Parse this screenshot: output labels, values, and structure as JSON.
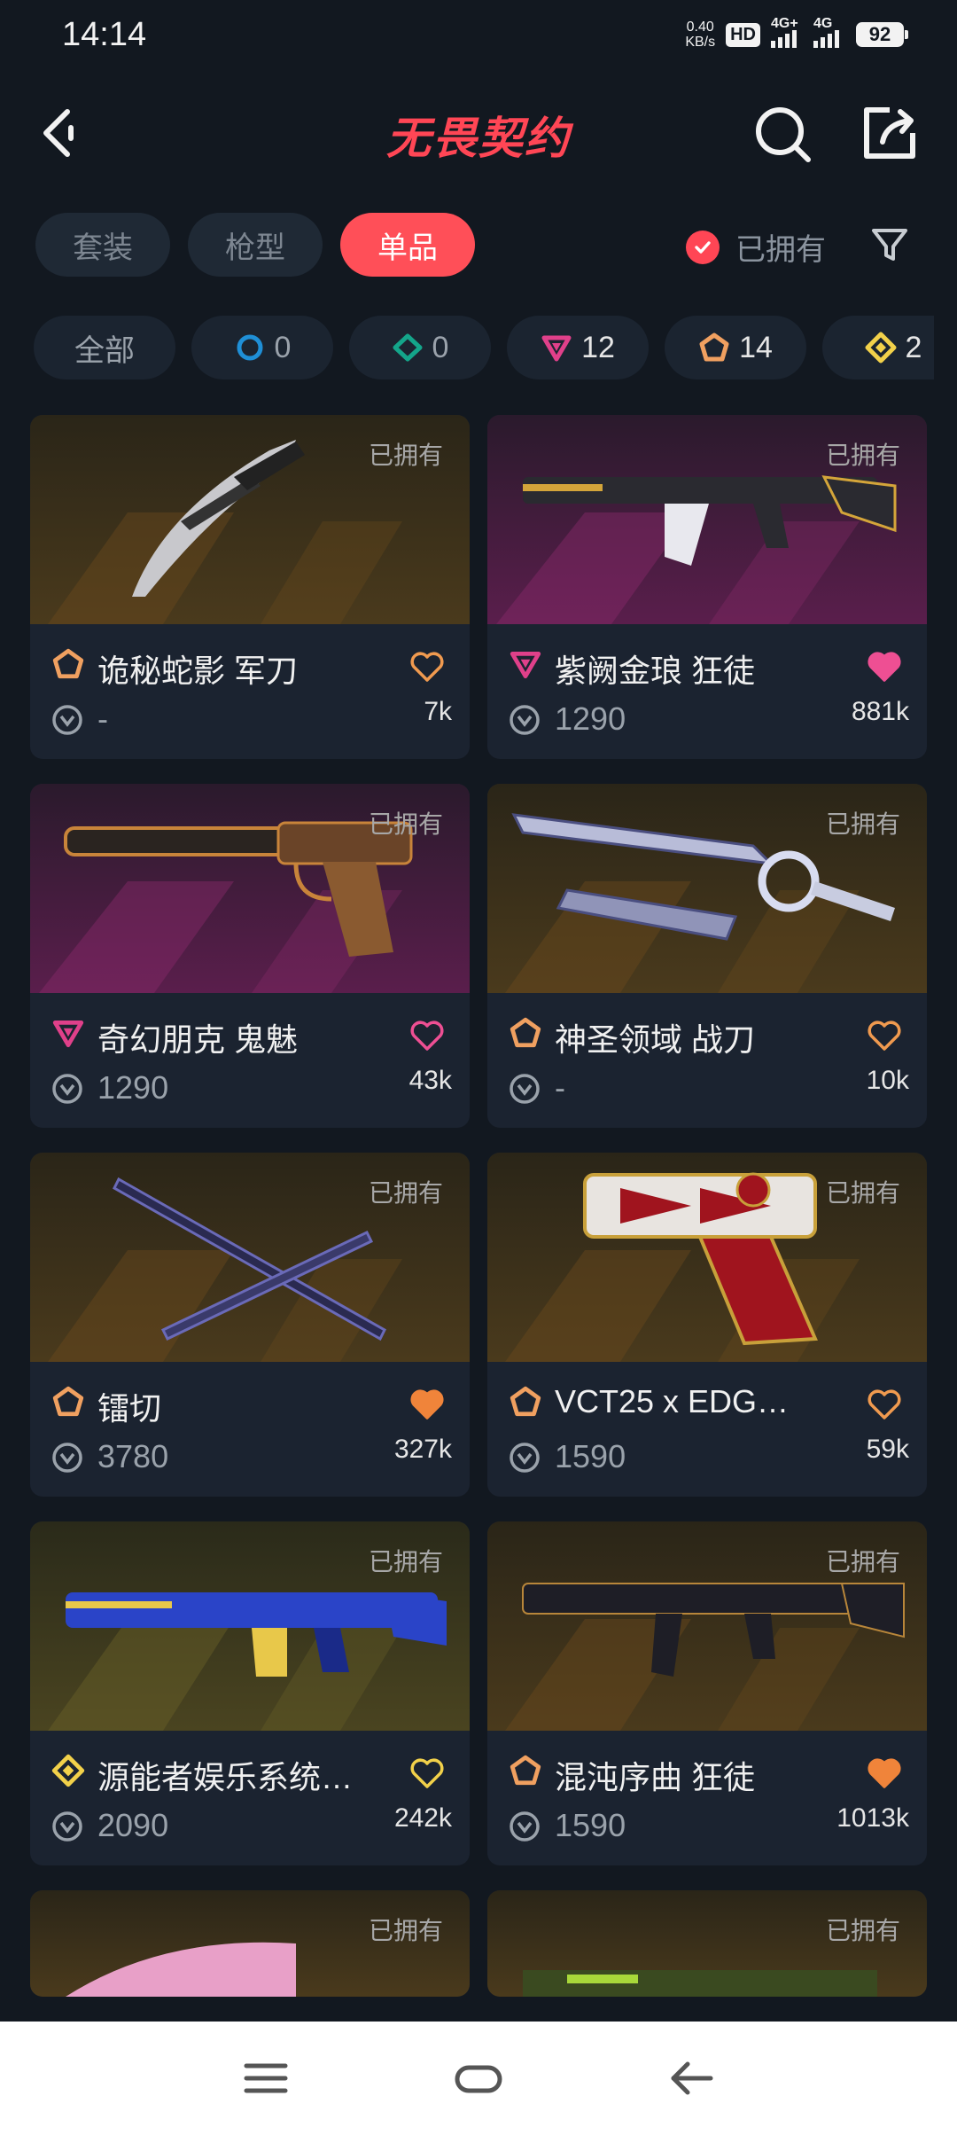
{
  "status": {
    "time": "14:14",
    "speed_top": "0.40",
    "speed_bottom": "KB/s",
    "hd": "HD",
    "net1": "4G+",
    "net2": "4G",
    "battery": "92"
  },
  "header": {
    "title": "无畏契约",
    "title_color": "#ff4655"
  },
  "tabs": [
    {
      "label": "套装"
    },
    {
      "label": "枪型"
    },
    {
      "label": "单品"
    }
  ],
  "owned_filter": {
    "label": "已拥有",
    "checked": true
  },
  "rarity_filters": [
    {
      "label": "全部",
      "icon": "none"
    },
    {
      "label": "0",
      "icon": "select-tier-icon",
      "color": "#1f8fd6"
    },
    {
      "label": "0",
      "icon": "deluxe-tier-icon",
      "color": "#14a58a"
    },
    {
      "label": "12",
      "icon": "premium-tier-icon",
      "color": "#e0408a"
    },
    {
      "label": "14",
      "icon": "exclusive-tier-icon",
      "color": "#f0a060"
    },
    {
      "label": "2",
      "icon": "ultra-tier-icon",
      "color": "#f2d14a"
    }
  ],
  "cards": [
    {
      "name": "诡秘蛇影 军刀",
      "price": "-",
      "likes": "7k",
      "owned": "已拥有",
      "rarity": "exclusive",
      "liked": false,
      "heart_color": "#f09a4f"
    },
    {
      "name": "紫阙金琅 狂徒",
      "price": "1290",
      "likes": "881k",
      "owned": "已拥有",
      "rarity": "premium",
      "liked": true,
      "heart_color": "#ee4f93"
    },
    {
      "name": "奇幻朋克 鬼魅",
      "price": "1290",
      "likes": "43k",
      "owned": "已拥有",
      "rarity": "premium",
      "liked": false,
      "heart_color": "#ee4f93"
    },
    {
      "name": "神圣领域 战刀",
      "price": "-",
      "likes": "10k",
      "owned": "已拥有",
      "rarity": "exclusive",
      "liked": false,
      "heart_color": "#f09a4f"
    },
    {
      "name": "镭切",
      "price": "3780",
      "likes": "327k",
      "owned": "已拥有",
      "rarity": "exclusive",
      "liked": true,
      "heart_color": "#f0843a"
    },
    {
      "name": "VCT25 x EDG…",
      "price": "1590",
      "likes": "59k",
      "owned": "已拥有",
      "rarity": "exclusive",
      "liked": false,
      "heart_color": "#f09a4f"
    },
    {
      "name": "源能者娱乐系统…",
      "price": "2090",
      "likes": "242k",
      "owned": "已拥有",
      "rarity": "ultra",
      "liked": false,
      "heart_color": "#f2d14a"
    },
    {
      "name": "混沌序曲 狂徒",
      "price": "1590",
      "likes": "1013k",
      "owned": "已拥有",
      "rarity": "exclusive",
      "liked": true,
      "heart_color": "#f0843a"
    },
    {
      "name": "",
      "price": "",
      "likes": "",
      "owned": "已拥有",
      "rarity": "",
      "liked": false,
      "heart_color": ""
    },
    {
      "name": "",
      "price": "",
      "likes": "",
      "owned": "已拥有",
      "rarity": "",
      "liked": false,
      "heart_color": ""
    }
  ]
}
